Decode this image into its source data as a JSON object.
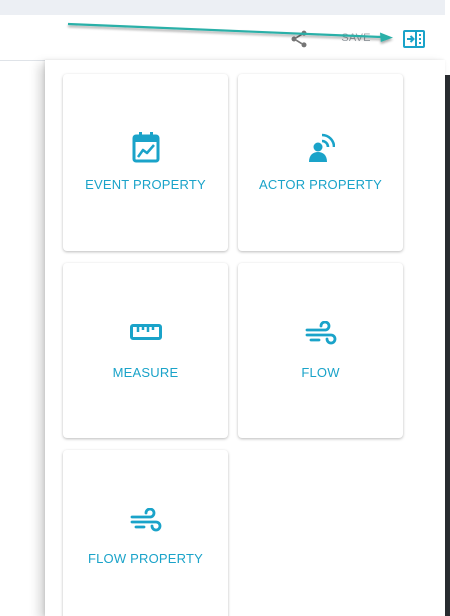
{
  "toolbar": {
    "save_label": "SAVE",
    "share_icon": "share-icon",
    "panel_icon": "panel-collapse-icon"
  },
  "cards": [
    {
      "label": "EVENT PROPERTY",
      "icon": "calendar-chart-icon"
    },
    {
      "label": "ACTOR PROPERTY",
      "icon": "person-signal-icon"
    },
    {
      "label": "MEASURE",
      "icon": "ruler-icon"
    },
    {
      "label": "FLOW",
      "icon": "wind-icon"
    },
    {
      "label": "FLOW PROPERTY",
      "icon": "wind-icon"
    }
  ],
  "colors": {
    "accent": "#1aa3c9",
    "arrow": "#2ab0a8",
    "toolbar_icon": "#757575",
    "save_text": "#9aa0a6"
  }
}
